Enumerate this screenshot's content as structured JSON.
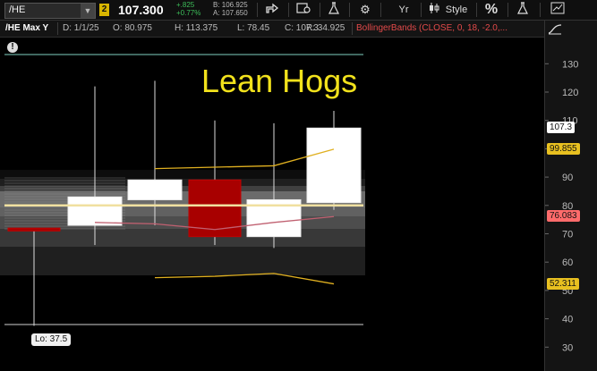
{
  "toolbar": {
    "symbol": "/HE",
    "link_badge": "2",
    "last_price": "107.300",
    "net_change": "+.825",
    "pct_change": "+0.77%",
    "bid": "B: 106.925",
    "ask": "A: 107.650",
    "timeframe_label": "Yr",
    "style_label": "Style",
    "percent_label": "%"
  },
  "infobar": {
    "title": "/HE Max Y",
    "date": "D: 1/1/25",
    "open": "O: 80.975",
    "high": "H: 113.375",
    "low": "L: 78.45",
    "close": "C: 107.3",
    "range": "R: 34.925",
    "study": "BollingerBands (CLOSE, 0, 18, -2.0,..."
  },
  "chart_title": "Lean Hogs",
  "event_marker": "!",
  "lo_label": "Lo: 37.5",
  "price_pills": {
    "last": {
      "text": "107.3",
      "value": 107.3,
      "bg": "#ffffff"
    },
    "upper": {
      "text": "99.855",
      "value": 99.855,
      "bg": "#e8c020"
    },
    "middle": {
      "text": "76.083",
      "value": 76.083,
      "bg": "#ff6b6b"
    },
    "lower": {
      "text": "52.311",
      "value": 52.311,
      "bg": "#e8c020"
    }
  },
  "colors": {
    "up_candle": "#ffffff",
    "down_candle": "#a80000",
    "upper_band": "#e0b020",
    "lower_band": "#e0b020",
    "mid_band": "#c06070",
    "price_line": "#f0e0a0",
    "accent_green": "#3dbf5a"
  },
  "chart_data": {
    "type": "candlestick",
    "timeframe": "Yearly",
    "y_ticks": [
      30,
      40,
      50,
      60,
      70,
      80,
      90,
      100,
      110,
      120,
      130
    ],
    "ylim": [
      25,
      137
    ],
    "candles": [
      {
        "o": 72,
        "h": 72,
        "l": 37.5,
        "c": 71
      },
      {
        "o": 73,
        "h": 122,
        "l": 66,
        "c": 83
      },
      {
        "o": 82,
        "h": 124,
        "l": 73,
        "c": 89
      },
      {
        "o": 89,
        "h": 110,
        "l": 66,
        "c": 69
      },
      {
        "o": 69,
        "h": 109,
        "l": 65,
        "c": 82
      },
      {
        "o": 81,
        "h": 113.375,
        "l": 78.45,
        "c": 107.3
      }
    ],
    "bollinger": {
      "upper": [
        null,
        null,
        93,
        93.5,
        94,
        99.855
      ],
      "middle": [
        null,
        74,
        73.5,
        71.5,
        74,
        76.083
      ],
      "lower": [
        null,
        null,
        54.5,
        55,
        56,
        52.311
      ]
    },
    "last_price_line": 80
  }
}
